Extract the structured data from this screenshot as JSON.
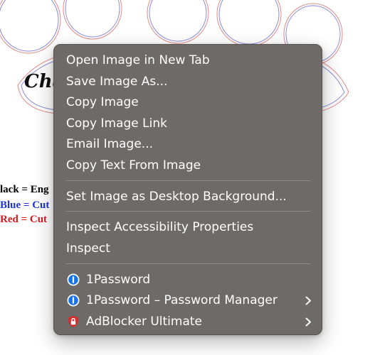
{
  "background_page": {
    "title_partial": "Cha",
    "legend": [
      {
        "text": "lack = Eng",
        "color": "#000000"
      },
      {
        "text": "Blue = Cut",
        "color": "#1a33d6"
      },
      {
        "text": "Red = Cut",
        "color": "#e0141b"
      }
    ]
  },
  "context_menu": {
    "groups": [
      {
        "items": [
          {
            "label": "Open Image in New Tab"
          },
          {
            "label": "Save Image As..."
          },
          {
            "label": "Copy Image"
          },
          {
            "label": "Copy Image Link"
          },
          {
            "label": "Email Image..."
          },
          {
            "label": "Copy Text From Image"
          }
        ]
      },
      {
        "items": [
          {
            "label": "Set Image as Desktop Background..."
          }
        ]
      },
      {
        "items": [
          {
            "label": "Inspect Accessibility Properties"
          },
          {
            "label": "Inspect"
          }
        ]
      },
      {
        "items": [
          {
            "label": "1Password",
            "icon": "1password-icon",
            "has_submenu": false
          },
          {
            "label": "1Password – Password Manager",
            "icon": "1password-icon",
            "has_submenu": true
          },
          {
            "label": "AdBlocker Ultimate",
            "icon": "adblocker-shield-icon",
            "has_submenu": true
          }
        ]
      }
    ]
  },
  "colors": {
    "menu_background": "#6d6a67",
    "menu_text": "#ffffff",
    "separator": "#8e8a86",
    "onepassword_blue": "#1a73e8",
    "adblocker_red": "#d32f2f",
    "paw_outline_blue": "#8a8ad8",
    "paw_outline_red": "#e38a8a"
  }
}
